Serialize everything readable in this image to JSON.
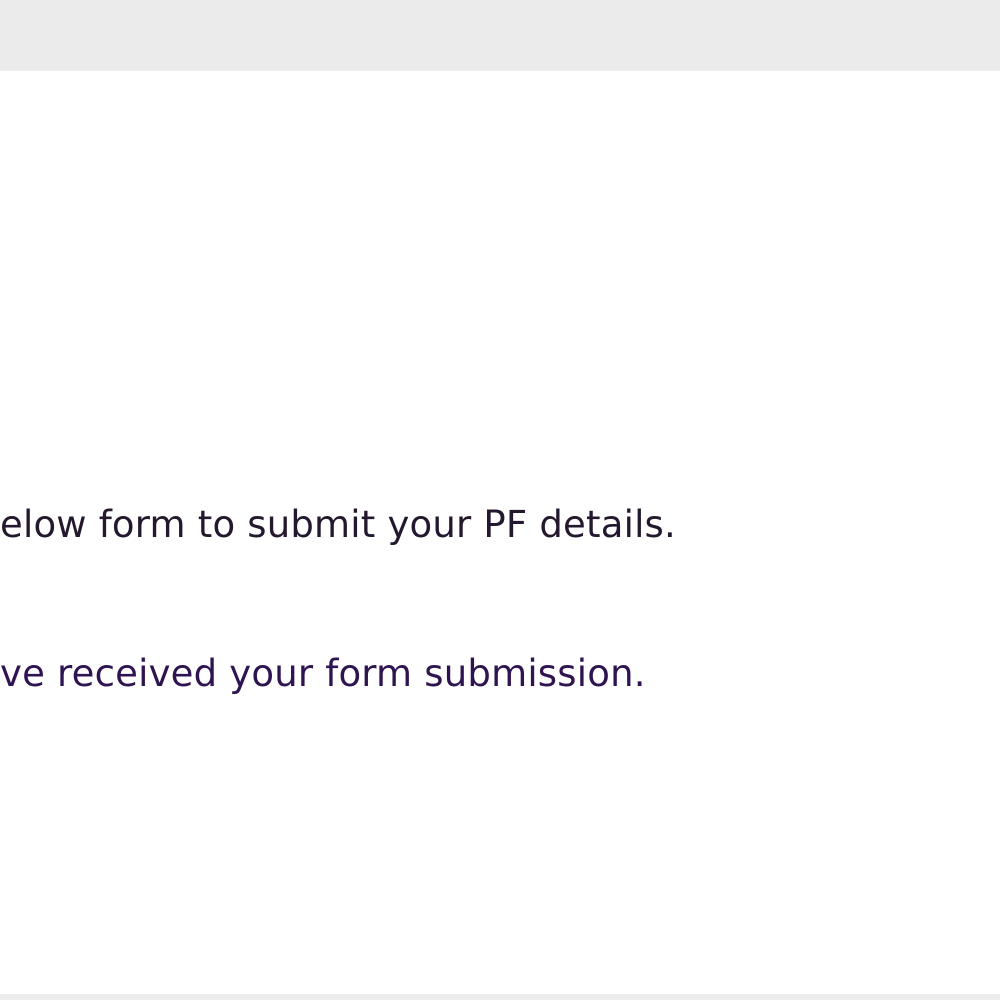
{
  "form_page": {
    "instruction_text": "elow form to submit your PF details.",
    "confirmation_text": "ve received your form submission."
  },
  "colors": {
    "top_bar": "#ebebeb",
    "panel_background": "#ffffff",
    "instruction_text": "#24182e",
    "confirmation_text": "#2e1450"
  }
}
